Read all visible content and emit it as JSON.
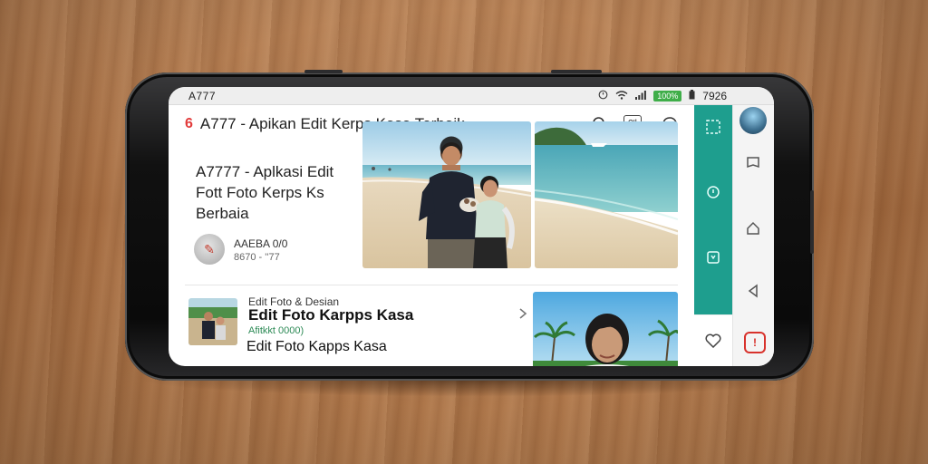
{
  "status_bar": {
    "time_left": "A777",
    "time_right": "7926",
    "battery_label": "100%"
  },
  "header": {
    "logo_glyph": "6",
    "title": "A777 - Apikan Edit Kerps Kasa Terbaik",
    "icons": [
      "search-icon",
      "translate-icon",
      "chat-icon"
    ]
  },
  "hero": {
    "title_line1": "A7777 - Aplkasi Edit",
    "title_line2": "Fott Foto Kerps Ks",
    "title_line3": "Berbaia",
    "author_name": "AAEBA 0/0",
    "author_meta": "8670 - ''77"
  },
  "list_item": {
    "category": "Edit Foto & Desian",
    "title": "Edit Foto Karpps Kasa",
    "subtitle": "Afitkkt 0000)",
    "title2": "Edit Foto Kapps Kasa"
  },
  "rail": {
    "icons": [
      "grid-icon",
      "refresh-icon",
      "save-icon"
    ]
  },
  "nav": {
    "icons": [
      "square-icon",
      "home-icon",
      "back-icon"
    ],
    "heart_icon": "heart-icon",
    "flag_glyph": "!"
  },
  "colors": {
    "accent": "#1e9e8e",
    "logo_red": "#e23b3b",
    "battery_green": "#3fae49"
  }
}
